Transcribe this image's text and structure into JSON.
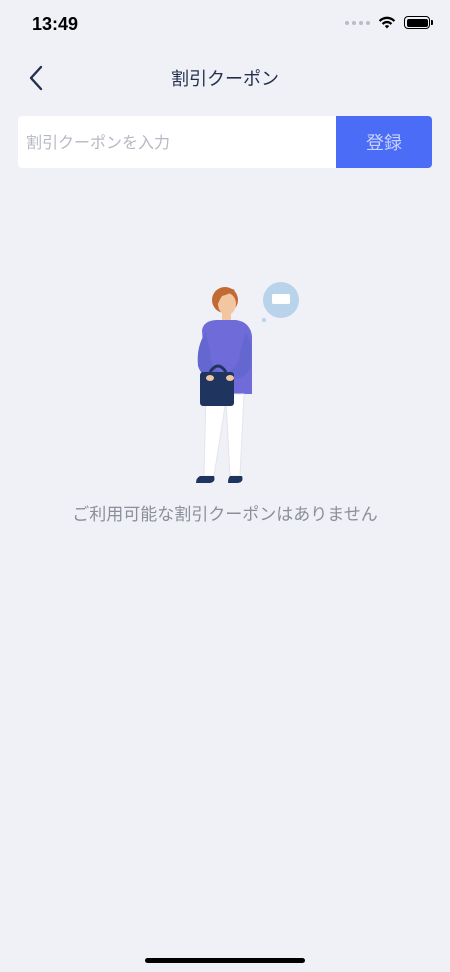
{
  "status_bar": {
    "time": "13:49",
    "icons": [
      "signal-dots-icon",
      "wifi-icon",
      "battery-icon"
    ]
  },
  "nav": {
    "title": "割引クーポン",
    "back_icon": "chevron-left-icon"
  },
  "coupon_form": {
    "placeholder": "割引クーポンを入力",
    "value": "",
    "register_label": "登録"
  },
  "empty_state": {
    "message": "ご利用可能な割引クーポンはありません",
    "illustration": "person-with-bag-and-speech-bubble"
  },
  "colors": {
    "background": "#f0f1f6",
    "accent": "#4a6cf7",
    "title": "#23304d",
    "muted_text": "#8b8f99"
  }
}
